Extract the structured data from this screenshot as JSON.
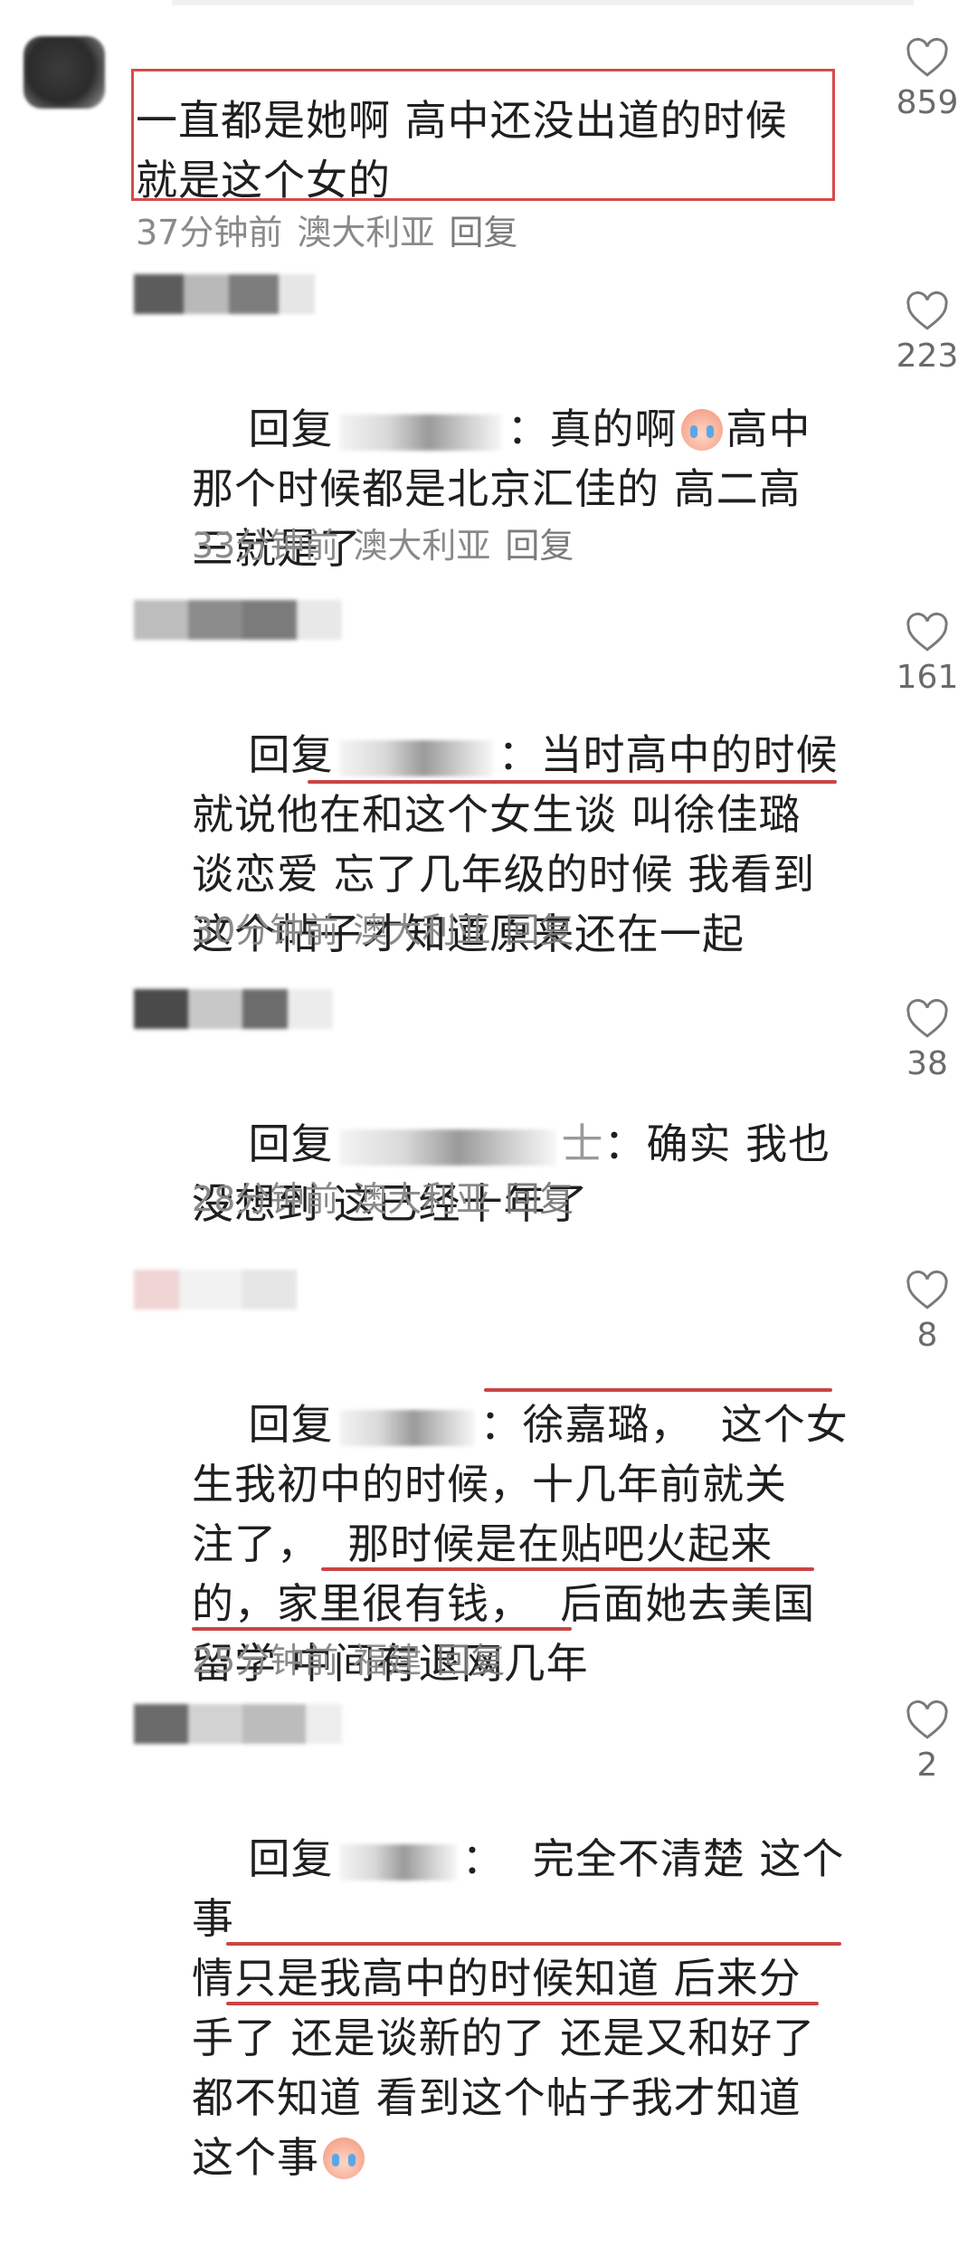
{
  "comments": [
    {
      "text": "一直都是她啊 高中还没出道的时候\n就是这个女的",
      "time": "37分钟前",
      "location": "澳大利亚",
      "reply_label": "回复",
      "likes": "859"
    },
    {
      "prefix": "回复",
      "text_a": "：真的啊",
      "text_b": "高中\n那个时候都是北京汇佳的 高二高\n三就是了",
      "time": "33分钟前",
      "location": "澳大利亚",
      "reply_label": "回复",
      "likes": "223"
    },
    {
      "prefix": "回复",
      "text": "：当时高中的时候\n就说他在和这个女生谈 叫徐佳璐\n谈恋爱 忘了几年级的时候 我看到\n这个帖子才知道原来还在一起",
      "time": "30分钟前",
      "location": "澳大利亚",
      "reply_label": "回复",
      "likes": "161"
    },
    {
      "prefix": "回复",
      "name_tail": "士",
      "text": "：确实 我也\n没想到 这已经十年了",
      "time": "28分钟前",
      "location": "澳大利亚",
      "reply_label": "回复",
      "likes": "38"
    },
    {
      "prefix": "回复",
      "text": "：徐嘉璐，  这个女\n生我初中的时候，十几年前就关\n注了，  那时候是在贴吧火起来\n的，家里很有钱，  后面她去美国\n留学 中间有退网几年",
      "time": "25分钟前",
      "location": "福建",
      "reply_label": "回复",
      "likes": "8"
    },
    {
      "prefix": "回复",
      "text": "：  完全不清楚 这个事\n情只是我高中的时候知道 后来分\n手了 还是谈新的了 还是又和好了\n都不知道 看到这个帖子我才知道\n这个事",
      "likes": "2"
    }
  ],
  "colors": {
    "highlight": "#d64b4b",
    "meta_text": "#8a8a8a",
    "body_text": "#1f1f1f"
  },
  "icons": {
    "like": "heart-outline-icon",
    "emoji": "crying-face-emoji"
  }
}
